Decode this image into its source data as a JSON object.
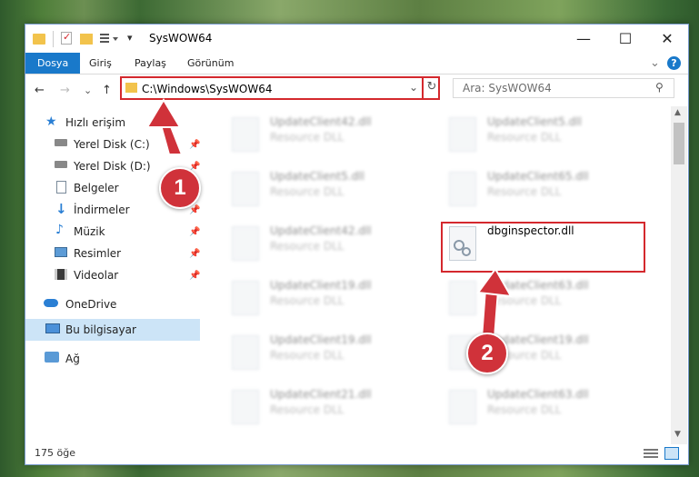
{
  "window": {
    "title": "SysWOW64",
    "buttons": {
      "minimize": "—",
      "maximize": "☐",
      "close": "✕"
    }
  },
  "ribbon": {
    "tabs": [
      "Dosya",
      "Giriş",
      "Paylaş",
      "Görünüm"
    ],
    "expand_glyph": "⌄",
    "help_glyph": "?"
  },
  "address_bar": {
    "back": "←",
    "forward": "→",
    "recent": "⌄",
    "up": "↑",
    "path": "C:\\Windows\\SysWOW64",
    "dropdown_glyph": "⌄",
    "refresh_glyph": "↻",
    "search_placeholder": "Ara: SysWOW64",
    "search_glyph": "⚲"
  },
  "sidebar": {
    "items": [
      {
        "label": "Hızlı erişim",
        "icon": "star-icon"
      },
      {
        "label": "Yerel Disk (C:)",
        "icon": "drive-icon",
        "pinned": true
      },
      {
        "label": "Yerel Disk (D:)",
        "icon": "drive-icon",
        "pinned": true
      },
      {
        "label": "Belgeler",
        "icon": "documents-icon",
        "pinned": true
      },
      {
        "label": "İndirmeler",
        "icon": "download-icon",
        "pinned": true
      },
      {
        "label": "Müzik",
        "icon": "music-icon",
        "pinned": true
      },
      {
        "label": "Resimler",
        "icon": "pictures-icon",
        "pinned": true
      },
      {
        "label": "Videolar",
        "icon": "video-icon",
        "pinned": true
      },
      {
        "label": "OneDrive",
        "icon": "cloud-icon"
      },
      {
        "label": "Bu bilgisayar",
        "icon": "computer-icon",
        "selected": true
      },
      {
        "label": "Ağ",
        "icon": "network-icon"
      }
    ],
    "pin_glyph": "📌"
  },
  "files": {
    "left": [
      {
        "name": "UpdateClient42.dll",
        "type": "Resource DLL"
      },
      {
        "name": "UpdateClient5.dll",
        "type": "Resource DLL"
      },
      {
        "name": "UpdateClient42.dll",
        "type": "Resource DLL"
      },
      {
        "name": "UpdateClient19.dll",
        "type": "Resource DLL"
      },
      {
        "name": "UpdateClient19.dll",
        "type": "Resource DLL"
      },
      {
        "name": "UpdateClient21.dll",
        "type": "Resource DLL"
      }
    ],
    "right": [
      {
        "name": "UpdateClient5.dll",
        "type": "Resource DLL"
      },
      {
        "name": "UpdateClient65.dll",
        "type": "Resource DLL"
      },
      {
        "name": "dbginspector.dll",
        "type": "",
        "highlighted": true
      },
      {
        "name": "UpdateClient63.dll",
        "type": "Resource DLL"
      },
      {
        "name": "UpdateClient19.dll",
        "type": "Resource DLL"
      },
      {
        "name": "UpdateClient63.dll",
        "type": "Resource DLL"
      }
    ]
  },
  "status_bar": {
    "item_count": "175 öğe"
  },
  "annotations": {
    "step1": "1",
    "step2": "2"
  },
  "colors": {
    "accent": "#1979ca",
    "highlight": "#d4282d",
    "badge": "#d0323a",
    "selected": "#cce4f7"
  }
}
